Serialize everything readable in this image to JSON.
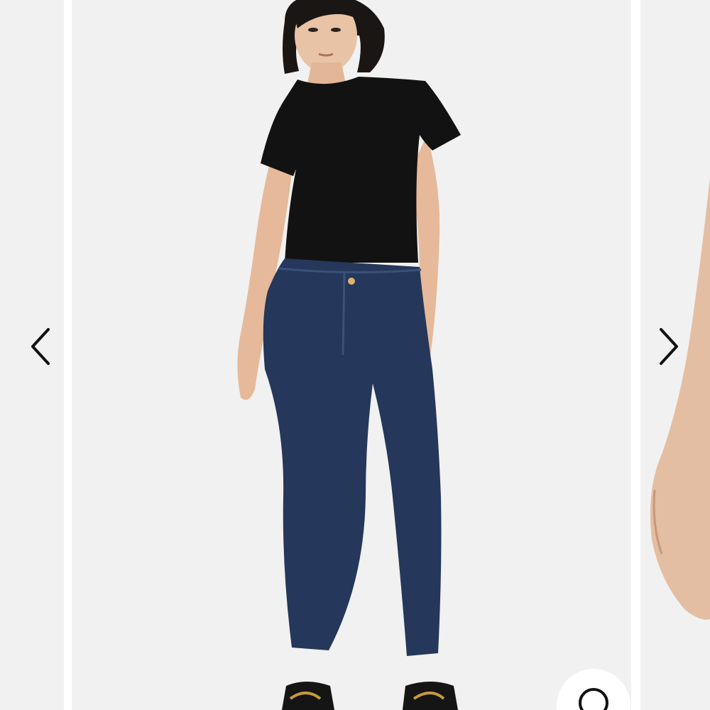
{
  "carousel": {
    "slides": [
      {
        "role": "previous",
        "image": "product-photo-partial"
      },
      {
        "role": "current",
        "image": "model-in-black-tee-and-dark-wash-skinny-jeans"
      },
      {
        "role": "next",
        "image": "product-photo-partial-arm"
      }
    ],
    "controls": {
      "prev_icon": "chevron-left-icon",
      "next_icon": "chevron-right-icon",
      "zoom_icon": "search-icon"
    }
  },
  "colors": {
    "slide_background": "#f1f1f1",
    "page_background": "#ffffff",
    "arrow": "#111111",
    "tee": "#111111",
    "denim": "#26375a",
    "skin": "#e7bfa2"
  }
}
